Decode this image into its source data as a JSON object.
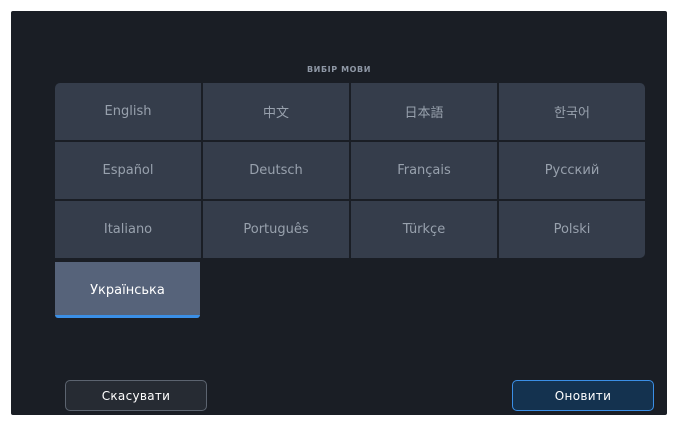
{
  "dialog": {
    "title": "ВИБІР МОВИ"
  },
  "languages": [
    {
      "label": "English",
      "name": "language-english"
    },
    {
      "label": "中文",
      "name": "language-chinese"
    },
    {
      "label": "日本語",
      "name": "language-japanese"
    },
    {
      "label": "한국어",
      "name": "language-korean"
    },
    {
      "label": "Español",
      "name": "language-spanish"
    },
    {
      "label": "Deutsch",
      "name": "language-german"
    },
    {
      "label": "Français",
      "name": "language-french"
    },
    {
      "label": "Русский",
      "name": "language-russian"
    },
    {
      "label": "Italiano",
      "name": "language-italian"
    },
    {
      "label": "Português",
      "name": "language-portuguese"
    },
    {
      "label": "Türkçe",
      "name": "language-turkish"
    },
    {
      "label": "Polski",
      "name": "language-polish"
    }
  ],
  "selected_language": {
    "label": "Українська"
  },
  "buttons": {
    "cancel_label": "Скасувати",
    "update_label": "Оновити"
  },
  "colors": {
    "background": "#1a1e25",
    "tile": "#353d4b",
    "tile_selected": "#56637a",
    "accent": "#3b8fe6"
  }
}
